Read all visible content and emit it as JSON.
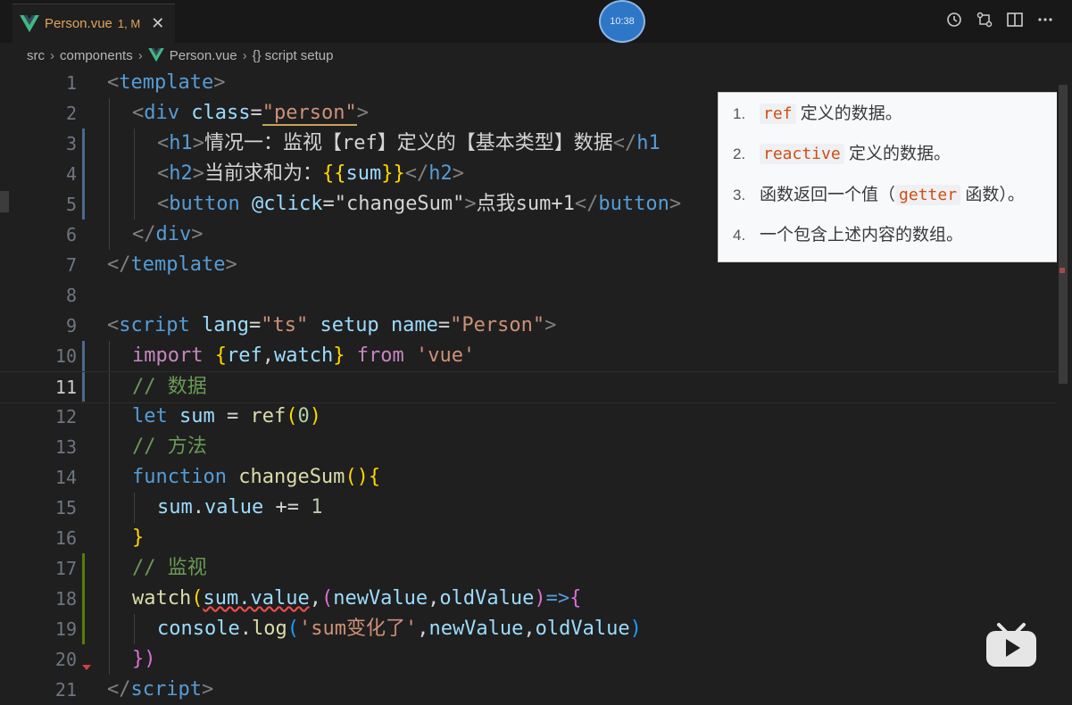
{
  "tab": {
    "title": "Person.vue",
    "flag": "1, M",
    "close": "✕"
  },
  "clock": "10:38",
  "breadcrumb": {
    "items": [
      "src",
      "components",
      "Person.vue",
      "{} script setup"
    ]
  },
  "editor": {
    "active_line": 11,
    "lines": [
      {
        "n": "1"
      },
      {
        "n": "2"
      },
      {
        "n": "3"
      },
      {
        "n": "4"
      },
      {
        "n": "5"
      },
      {
        "n": "6"
      },
      {
        "n": "7"
      },
      {
        "n": "8"
      },
      {
        "n": "9"
      },
      {
        "n": "10"
      },
      {
        "n": "11"
      },
      {
        "n": "12"
      },
      {
        "n": "13"
      },
      {
        "n": "14"
      },
      {
        "n": "15"
      },
      {
        "n": "16"
      },
      {
        "n": "17"
      },
      {
        "n": "18"
      },
      {
        "n": "19"
      },
      {
        "n": "20"
      },
      {
        "n": "21"
      }
    ],
    "code": {
      "l1": [
        "<",
        "template",
        ">"
      ],
      "l2": [
        "<",
        "div",
        "class",
        "=",
        "\"person\"",
        ">"
      ],
      "l3": [
        "<",
        "h1",
        ">",
        "情况一：监视【ref】定义的【基本类型】数据",
        "</",
        "h1"
      ],
      "l4": [
        "<",
        "h2",
        ">",
        "当前求和为：",
        "{{",
        "sum",
        "}}",
        "</",
        "h2",
        ">"
      ],
      "l5": [
        "<",
        "button",
        "@click",
        "=",
        "\"changeSum\"",
        ">",
        "点我sum+1",
        "</",
        "button",
        ">"
      ],
      "l6": [
        "</",
        "div",
        ">"
      ],
      "l7": [
        "</",
        "template",
        ">"
      ],
      "l9": [
        "<",
        "script",
        "lang",
        "=",
        "\"ts\"",
        "setup",
        "name",
        "=",
        "\"Person\"",
        ">"
      ],
      "l10": [
        "import",
        "{",
        "ref",
        ",",
        "watch",
        "}",
        "from",
        "'vue'"
      ],
      "l11": "// 数据",
      "l12": [
        "let",
        "sum",
        "=",
        "ref",
        "(",
        "0",
        ")"
      ],
      "l13": "// 方法",
      "l14": [
        "function",
        "changeSum",
        "(){"
      ],
      "l15": [
        "sum",
        ".",
        "value",
        "+=",
        "1"
      ],
      "l16": "}",
      "l17": "// 监视",
      "l18": [
        "watch",
        "(",
        "sum.value",
        ",",
        "(",
        "newValue",
        ",",
        "oldValue",
        ")",
        "=>",
        "{"
      ],
      "l19": [
        "console",
        ".",
        "log",
        "(",
        "'sum变化了'",
        ",",
        "newValue",
        ",",
        "oldValue",
        ")"
      ],
      "l20": [
        "})"
      ],
      "l21": [
        "</",
        "script",
        ">"
      ]
    }
  },
  "popup": {
    "items": [
      {
        "num": "1.",
        "code": "ref",
        "text": "定义的数据。"
      },
      {
        "num": "2.",
        "code": "reactive",
        "text": "定义的数据。"
      },
      {
        "num": "3.",
        "pre": "函数返回一个值（",
        "code": "getter",
        "text": "函数）。"
      },
      {
        "num": "4.",
        "text": "一个包含上述内容的数组。"
      }
    ]
  },
  "colors": {
    "tab_title": "#e2a45c",
    "keyword": "#569cd6",
    "string": "#ce9178",
    "comment": "#6a9955",
    "function": "#dcdcaa",
    "variable": "#9cdcfe",
    "control": "#c586c0",
    "popup_code": "#d14d12"
  }
}
